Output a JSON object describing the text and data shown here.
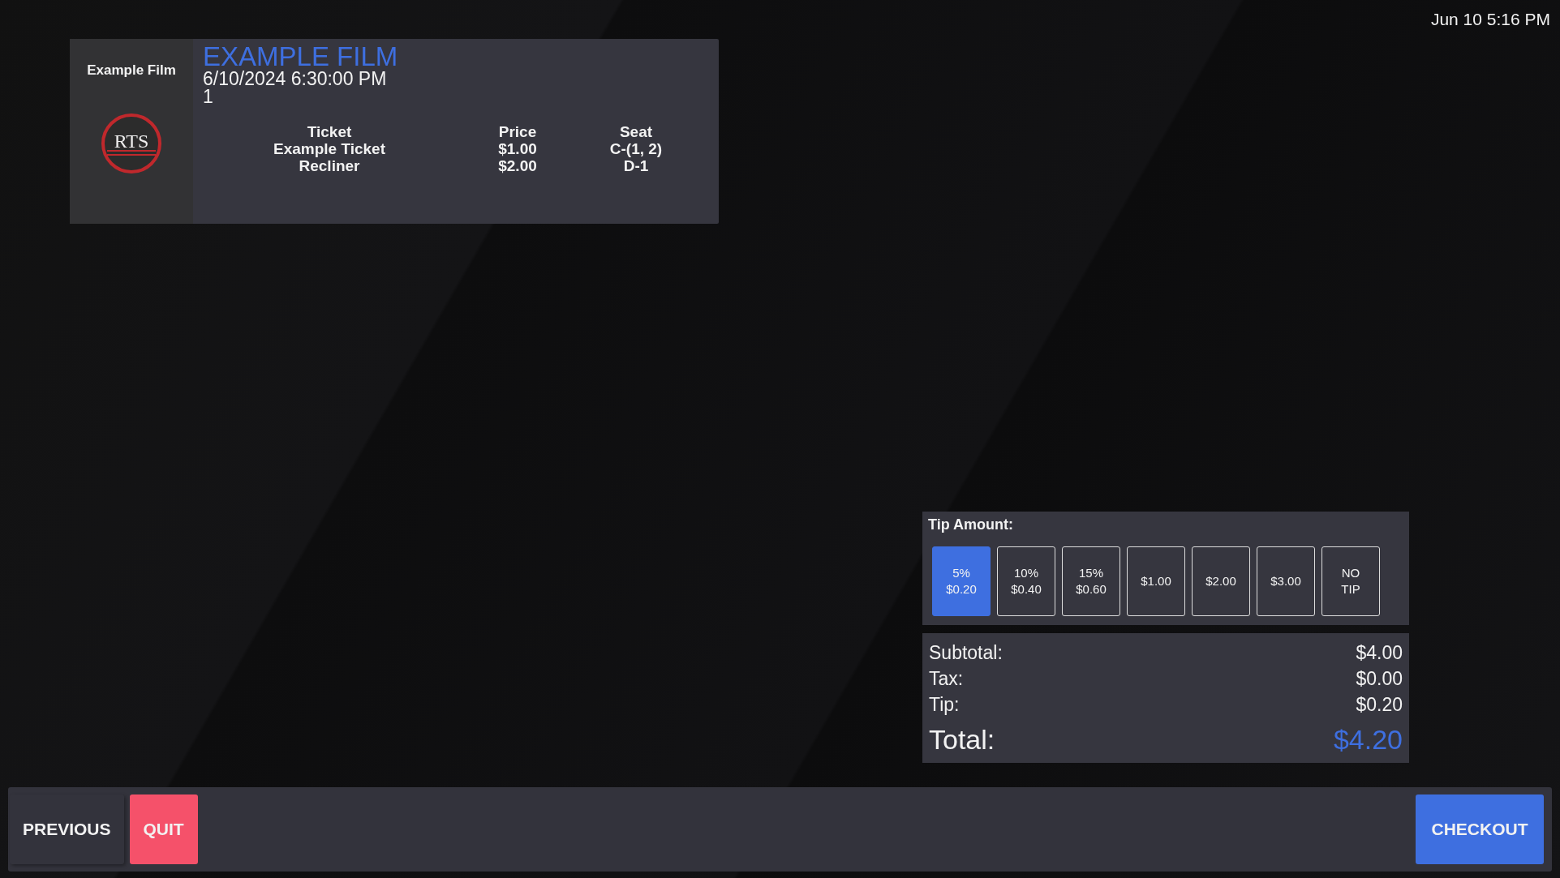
{
  "clock": "Jun 10 5:16 PM",
  "film_card": {
    "poster_title": "Example Film",
    "logo_text": "RTS",
    "title": "EXAMPLE FILM",
    "showtime": "6/10/2024 6:30:00 PM",
    "quantity": "1",
    "columns": [
      "Ticket",
      "Price",
      "Seat"
    ],
    "rows": [
      [
        "Example Ticket",
        "$1.00",
        "C-(1, 2)"
      ],
      [
        "Recliner",
        "$2.00",
        "D-1"
      ]
    ]
  },
  "tip": {
    "label": "Tip Amount:",
    "options": [
      {
        "lines": [
          "5%",
          "$0.20"
        ],
        "selected": true
      },
      {
        "lines": [
          "10%",
          "$0.40"
        ],
        "selected": false
      },
      {
        "lines": [
          "15%",
          "$0.60"
        ],
        "selected": false
      },
      {
        "lines": [
          "$1.00"
        ],
        "selected": false
      },
      {
        "lines": [
          "$2.00"
        ],
        "selected": false
      },
      {
        "lines": [
          "$3.00"
        ],
        "selected": false
      },
      {
        "lines": [
          "NO",
          "TIP"
        ],
        "selected": false
      }
    ]
  },
  "summary": {
    "lines": [
      {
        "label": "Subtotal:",
        "value": "$4.00"
      },
      {
        "label": "Tax:",
        "value": "$0.00"
      },
      {
        "label": "Tip:",
        "value": "$0.20"
      }
    ],
    "total": {
      "label": "Total:",
      "value": "$4.20"
    }
  },
  "footer": {
    "buttons": [
      {
        "label": "PREVIOUS",
        "kind": "plain"
      },
      {
        "label": "QUIT",
        "kind": "danger"
      },
      {
        "label": "CHECKOUT",
        "kind": "primary"
      }
    ]
  }
}
